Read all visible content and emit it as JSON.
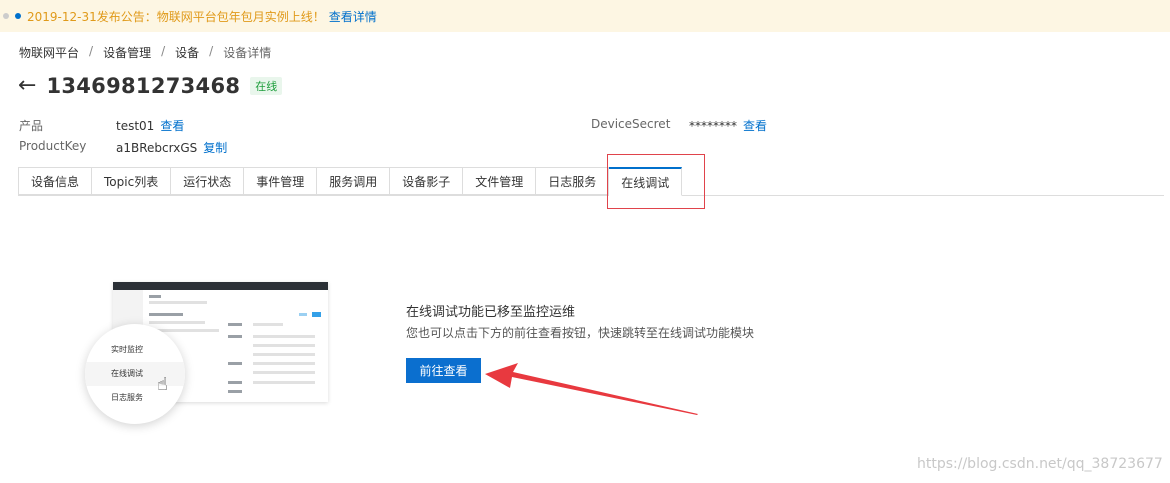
{
  "notice": {
    "text": "2019-12-31发布公告：物联网平台包年包月实例上线！",
    "link": "查看详情"
  },
  "breadcrumb": [
    "物联网平台",
    "设备管理",
    "设备",
    "设备详情"
  ],
  "breadcrumb_sep": "/",
  "device": {
    "title": "1346981273468",
    "status": "在线",
    "back_icon": "←"
  },
  "info": {
    "product_label": "产品",
    "product_value": "test01",
    "product_link": "查看",
    "productkey_label": "ProductKey",
    "productkey_value": "a1BRebcrxGS",
    "productkey_link": "复制",
    "secret_label": "DeviceSecret",
    "secret_value": "********",
    "secret_link": "查看"
  },
  "tabs": [
    "设备信息",
    "Topic列表",
    "运行状态",
    "事件管理",
    "服务调用",
    "设备影子",
    "文件管理",
    "日志服务",
    "在线调试"
  ],
  "active_tab": "在线调试",
  "illustration": {
    "menu": [
      "实时监控",
      "在线调试",
      "日志服务"
    ]
  },
  "message": {
    "title": "在线调试功能已移至监控运维",
    "subtitle": "您也可以点击下方的前往查看按钮，快速跳转至在线调试功能模块",
    "button": "前往查看"
  },
  "watermark": "https://blog.csdn.net/qq_38723677",
  "colors": {
    "accent": "#0070cc",
    "notice_bg": "#fdf6e3",
    "notice_text": "#e09a1a",
    "status_green": "#1e9e3c",
    "annotation_red": "#e0434b"
  }
}
